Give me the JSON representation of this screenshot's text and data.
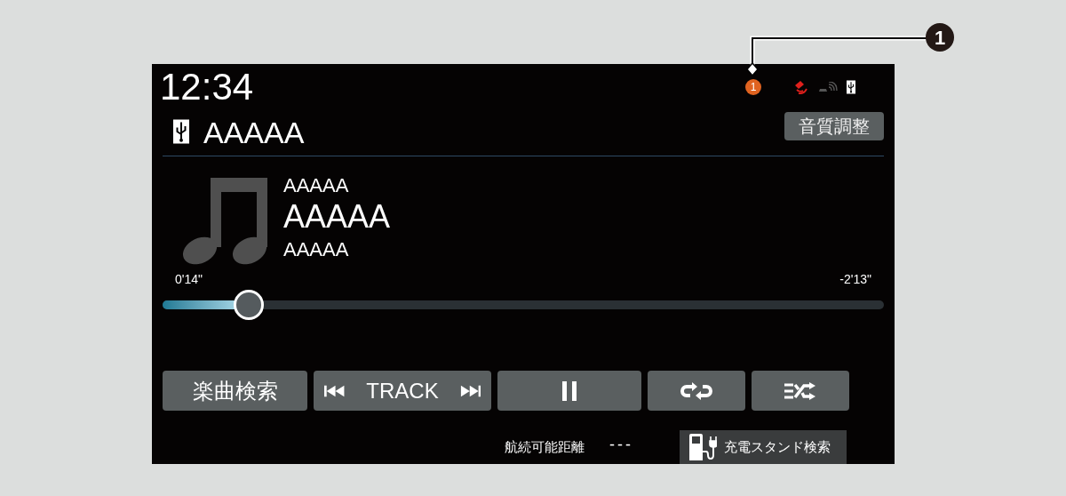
{
  "callout": {
    "label": "1"
  },
  "status": {
    "time": "12:34",
    "badge": "1"
  },
  "source": {
    "name": "AAAAA",
    "button": "音質調整"
  },
  "track": {
    "line_1": "AAAAA",
    "title": "AAAAA",
    "line_3": "AAAAA"
  },
  "progress": {
    "elapsed": "0'14\"",
    "remaining": "-2'13\"",
    "level": 0.12
  },
  "controls": [
    {
      "kind": "text",
      "label": "楽曲検索"
    },
    {
      "kind": "track",
      "label": "TRACK"
    },
    {
      "kind": "pause"
    },
    {
      "kind": "repeat"
    },
    {
      "kind": "shuffle"
    }
  ],
  "footer": {
    "range_label": "航続可能距離",
    "range_value": "---",
    "station_button": "充電スタンド検索"
  }
}
